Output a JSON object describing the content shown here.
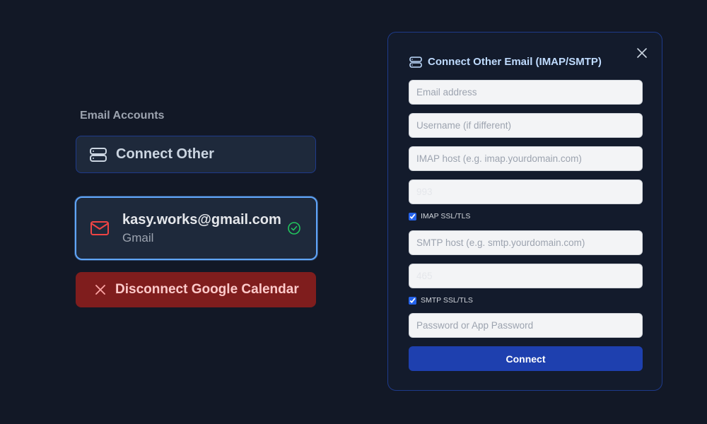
{
  "left": {
    "section_label": "Email Accounts",
    "connect_other": {
      "label": "Connect Other",
      "icon": "server-icon"
    },
    "account": {
      "email": "kasy.works@gmail.com",
      "provider": "Gmail",
      "icon": "mail-icon",
      "status_icon": "check-circle-icon"
    },
    "disconnect": {
      "label": "Disconnect Google Calendar",
      "icon": "close-icon"
    }
  },
  "panel": {
    "title": "Connect Other Email (IMAP/SMTP)",
    "title_icon": "server-icon",
    "close_icon": "close-icon",
    "fields": {
      "email_placeholder": "Email address",
      "username_placeholder": "Username (if different)",
      "imap_host_placeholder": "IMAP host (e.g. imap.yourdomain.com)",
      "imap_port_placeholder": "993",
      "smtp_host_placeholder": "SMTP host (e.g. smtp.yourdomain.com)",
      "smtp_port_placeholder": "465",
      "password_placeholder": "Password or App Password"
    },
    "imap_ssl": {
      "label": "IMAP SSL/TLS",
      "checked": true
    },
    "smtp_ssl": {
      "label": "SMTP SSL/TLS",
      "checked": true
    },
    "submit_label": "Connect"
  },
  "colors": {
    "background": "#121826",
    "accent": "#1e40af",
    "selected_border": "#60a5fa",
    "danger": "#7f1d1d",
    "success": "#22c55e",
    "mail_icon": "#ef4444"
  }
}
